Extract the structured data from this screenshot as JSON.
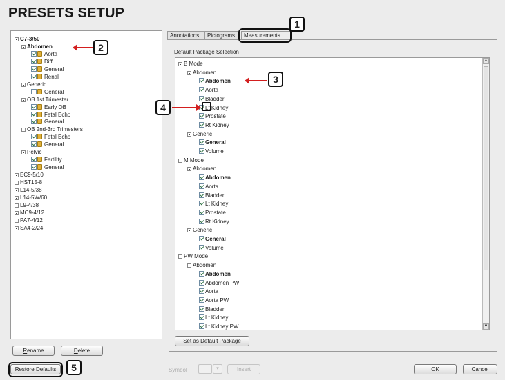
{
  "header": {
    "title": "PRESETS SETUP"
  },
  "left_tree": [
    {
      "label": "C7-3/50",
      "level": 0,
      "expander": "minus",
      "bold": true
    },
    {
      "label": "Abdomen",
      "level": 1,
      "expander": "minus",
      "bold": true
    },
    {
      "label": "Aorta",
      "level": 2,
      "checked": true,
      "lock": true
    },
    {
      "label": "Diff",
      "level": 2,
      "checked": true,
      "lock": true
    },
    {
      "label": "General",
      "level": 2,
      "checked": true,
      "lock": true
    },
    {
      "label": "Renal",
      "level": 2,
      "checked": true,
      "lock": true
    },
    {
      "label": "Generic",
      "level": 1,
      "expander": "minus"
    },
    {
      "label": "General",
      "level": 2,
      "checked": false,
      "lock": true
    },
    {
      "label": "OB 1st Trimester",
      "level": 1,
      "expander": "minus"
    },
    {
      "label": "Early OB",
      "level": 2,
      "checked": true,
      "lock": true
    },
    {
      "label": "Fetal Echo",
      "level": 2,
      "checked": true,
      "lock": true
    },
    {
      "label": "General",
      "level": 2,
      "checked": true,
      "lock": true
    },
    {
      "label": "OB 2nd-3rd Trimesters",
      "level": 1,
      "expander": "minus"
    },
    {
      "label": "Fetal Echo",
      "level": 2,
      "checked": true,
      "lock": true
    },
    {
      "label": "General",
      "level": 2,
      "checked": true,
      "lock": true
    },
    {
      "label": "Pelvic",
      "level": 1,
      "expander": "minus"
    },
    {
      "label": "Fertility",
      "level": 2,
      "checked": true,
      "lock": true
    },
    {
      "label": "General",
      "level": 2,
      "checked": true,
      "lock": true
    },
    {
      "label": "EC9-5/10",
      "level": 0,
      "expander": "plus"
    },
    {
      "label": "HST15-8",
      "level": 0,
      "expander": "plus"
    },
    {
      "label": "L14-5/38",
      "level": 0,
      "expander": "plus"
    },
    {
      "label": "L14-5W/60",
      "level": 0,
      "expander": "plus"
    },
    {
      "label": "L9-4/38",
      "level": 0,
      "expander": "plus"
    },
    {
      "label": "MC9-4/12",
      "level": 0,
      "expander": "plus"
    },
    {
      "label": "PA7-4/12",
      "level": 0,
      "expander": "plus"
    },
    {
      "label": "SA4-2/24",
      "level": 0,
      "expander": "plus"
    }
  ],
  "left_buttons": {
    "rename": "Rename",
    "delete": "Delete",
    "restore": "Restore Defaults"
  },
  "tabs": [
    {
      "label": "Annotations",
      "active": false
    },
    {
      "label": "Pictograms",
      "active": false
    },
    {
      "label": "Measurements",
      "active": true
    }
  ],
  "right": {
    "section_label": "Default Package Selection",
    "set_default_button": "Set as Default Package",
    "tree": [
      {
        "label": "B Mode",
        "level": 0,
        "expander": "minus"
      },
      {
        "label": "Abdomen",
        "level": 1,
        "expander": "minus"
      },
      {
        "label": "Abdomen",
        "level": 2,
        "checked": true,
        "bold": true
      },
      {
        "label": "Aorta",
        "level": 2,
        "checked": true
      },
      {
        "label": "Bladder",
        "level": 2,
        "checked": true
      },
      {
        "label": "Lt Kidney",
        "level": 2,
        "checked": true
      },
      {
        "label": "Prostate",
        "level": 2,
        "checked": true
      },
      {
        "label": "Rt Kidney",
        "level": 2,
        "checked": true
      },
      {
        "label": "Generic",
        "level": 1,
        "expander": "minus"
      },
      {
        "label": "General",
        "level": 2,
        "checked": true,
        "bold": true
      },
      {
        "label": "Volume",
        "level": 2,
        "checked": true
      },
      {
        "label": "M Mode",
        "level": 0,
        "expander": "minus"
      },
      {
        "label": "Abdomen",
        "level": 1,
        "expander": "minus"
      },
      {
        "label": "Abdomen",
        "level": 2,
        "checked": true,
        "bold": true
      },
      {
        "label": "Aorta",
        "level": 2,
        "checked": true
      },
      {
        "label": "Bladder",
        "level": 2,
        "checked": true
      },
      {
        "label": "Lt Kidney",
        "level": 2,
        "checked": true
      },
      {
        "label": "Prostate",
        "level": 2,
        "checked": true
      },
      {
        "label": "Rt Kidney",
        "level": 2,
        "checked": true
      },
      {
        "label": "Generic",
        "level": 1,
        "expander": "minus"
      },
      {
        "label": "General",
        "level": 2,
        "checked": true,
        "bold": true
      },
      {
        "label": "Volume",
        "level": 2,
        "checked": true
      },
      {
        "label": "PW Mode",
        "level": 0,
        "expander": "minus"
      },
      {
        "label": "Abdomen",
        "level": 1,
        "expander": "minus"
      },
      {
        "label": "Abdomen",
        "level": 2,
        "checked": true,
        "bold": true
      },
      {
        "label": "Abdomen PW",
        "level": 2,
        "checked": true
      },
      {
        "label": "Aorta",
        "level": 2,
        "checked": true
      },
      {
        "label": "Aorta PW",
        "level": 2,
        "checked": true
      },
      {
        "label": "Bladder",
        "level": 2,
        "checked": true
      },
      {
        "label": "Lt Kidney",
        "level": 2,
        "checked": true
      },
      {
        "label": "Lt Kidney PW",
        "level": 2,
        "checked": true
      }
    ]
  },
  "bottom": {
    "symbol_label": "Symbol",
    "insert": "Insert",
    "ok": "OK",
    "cancel": "Cancel"
  },
  "callouts": [
    "1",
    "2",
    "3",
    "4",
    "5"
  ],
  "colors": {
    "arrow": "#d31f1f",
    "lock": "#e2b23a"
  }
}
